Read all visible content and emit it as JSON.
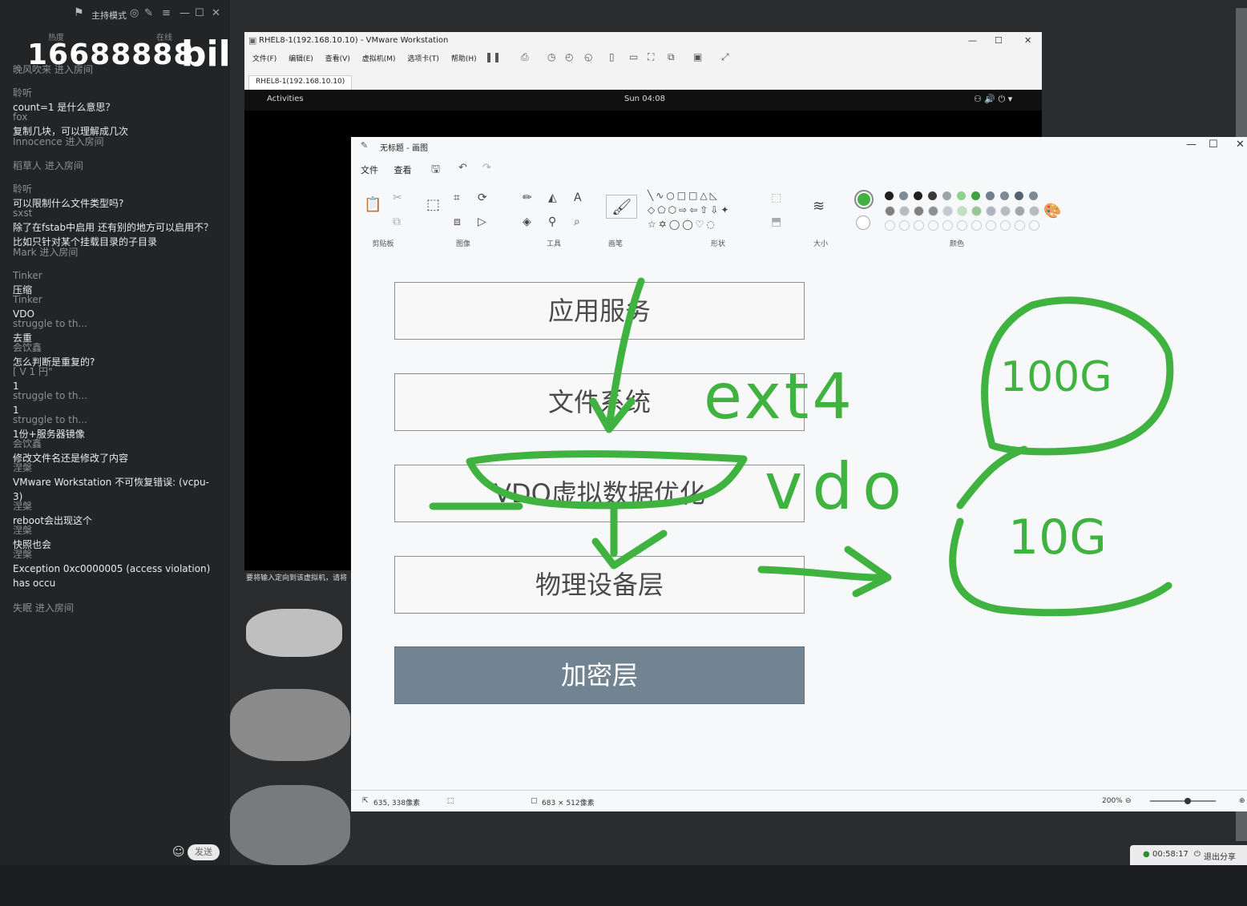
{
  "chat": {
    "mode_label": "主持模式",
    "hot_label": "热度",
    "online_label": "在线",
    "hot_value": "16688888",
    "logo_text": "bili",
    "messages": [
      {
        "type": "join",
        "text": "晚风吹来 进入房间"
      },
      {
        "type": "msg",
        "user": "聆听",
        "text": "count=1 是什么意思？"
      },
      {
        "type": "msg",
        "user": "fox",
        "text": "复制几块，可以理解成几次"
      },
      {
        "type": "join",
        "text": "Innocence 进入房间"
      },
      {
        "type": "join",
        "text": "稻草人 进入房间"
      },
      {
        "type": "msg",
        "user": "聆听",
        "text": "可以限制什么文件类型吗?"
      },
      {
        "type": "msg",
        "user": "sxst",
        "text": "除了在fstab中启用 还有别的地方可以启用不？比如只针对某个挂载目录的子目录"
      },
      {
        "type": "join",
        "text": "Mark 进入房间"
      },
      {
        "type": "msg",
        "user": "Tinker",
        "text": "压缩"
      },
      {
        "type": "msg",
        "user": "Tinker",
        "text": "VDO"
      },
      {
        "type": "msg",
        "user": "struggle to th...",
        "text": "去重"
      },
      {
        "type": "msg",
        "user": "会饮鑫",
        "text": "怎么判断是重复的?"
      },
      {
        "type": "msg",
        "user": "[ V 1 円\"",
        "text": "1"
      },
      {
        "type": "msg",
        "user": "struggle to th...",
        "text": "1"
      },
      {
        "type": "msg",
        "user": "struggle to th...",
        "text": "1份+服务器镜像"
      },
      {
        "type": "msg",
        "user": "会饮鑫",
        "text": "修改文件名还是修改了内容"
      },
      {
        "type": "msg",
        "user": "涅槃",
        "text": "VMware Workstation 不可恢复错误: (vcpu-3)"
      },
      {
        "type": "msg",
        "user": "涅槃",
        "text": "reboot会出现这个"
      },
      {
        "type": "msg",
        "user": "涅槃",
        "text": "快照也会"
      },
      {
        "type": "msg",
        "user": "涅槃",
        "text": "Exception 0xc0000005 (access violation) has occu"
      },
      {
        "type": "join",
        "text": "失眠 进入房间"
      }
    ],
    "send_label": "发送"
  },
  "vmware": {
    "title": "RHEL8-1(192.168.10.10) - VMware Workstation",
    "menu": [
      "文件(F)",
      "编辑(E)",
      "查看(V)",
      "虚拟机(M)",
      "选项卡(T)",
      "帮助(H)"
    ],
    "tab_label": "RHEL8-1(192.168.10.10)",
    "guest_activities": "Activities",
    "guest_clock": "Sun 04:08",
    "hint": "要将输入定向到该虚拟机，请将"
  },
  "paint": {
    "title": "无标题 - 画图",
    "menu": [
      "文件",
      "查看"
    ],
    "groups": [
      "剪贴板",
      "图像",
      "工具",
      "画笔",
      "形状",
      "大小",
      "颜色"
    ],
    "layers": [
      "应用服务",
      "文件系统",
      "VDO虚拟数据优化",
      "物理设备层",
      "加密层"
    ],
    "annotations": [
      "ext4",
      "vdo",
      "100G",
      "10G"
    ],
    "status": {
      "cursor": "635, 338像素",
      "canvas_size": "683 × 512像素",
      "zoom": "200%"
    },
    "palette_row1": [
      "#1f1f1f",
      "#7f8a93",
      "#1f1f1f",
      "#3a3a3a",
      "#9aa4ab",
      "#8fd18f",
      "#3fa13f",
      "#6f7f8c",
      "#7f8a93",
      "#556270",
      "#7f8a93"
    ],
    "accent_green": "#3fb23f"
  },
  "share": {
    "timer": "00:58:17",
    "label": "退出分享"
  }
}
